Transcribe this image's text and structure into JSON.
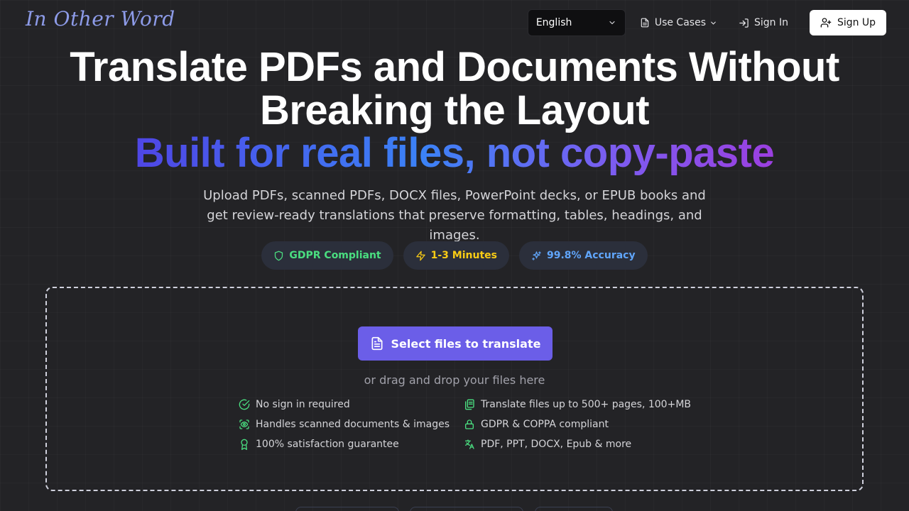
{
  "header": {
    "logo": "In Other Word",
    "language": "English",
    "use_cases": "Use Cases",
    "sign_in": "Sign In",
    "sign_up": "Sign Up"
  },
  "hero": {
    "title": "Translate PDFs and Documents Without Breaking the Layout",
    "subtitle": "Built for real files, not copy-paste",
    "description": "Upload PDFs, scanned PDFs, DOCX files, PowerPoint decks, or EPUB books and get review-ready translations that preserve formatting, tables, headings, and images."
  },
  "badges": [
    {
      "label": "GDPR Compliant",
      "icon": "shield-icon",
      "color": "#4ade80"
    },
    {
      "label": "1-3 Minutes",
      "icon": "lightning-icon",
      "color": "#facc15"
    },
    {
      "label": "99.8% Accuracy",
      "icon": "sparkles-icon",
      "color": "#60a5fa"
    }
  ],
  "upload": {
    "button": "Select files to translate",
    "drag_text": "or drag and drop your files here",
    "features": [
      {
        "label": "No sign in required",
        "icon": "check-circle-icon"
      },
      {
        "label": "Translate files up to 500+ pages, 100+MB",
        "icon": "files-icon"
      },
      {
        "label": "Handles scanned documents & images",
        "icon": "scan-eye-icon"
      },
      {
        "label": "GDPR & COPPA compliant",
        "icon": "lock-icon"
      },
      {
        "label": "100% satisfaction guarantee",
        "icon": "award-icon"
      },
      {
        "label": "PDF, PPT, DOCX, Epub & more",
        "icon": "translate-icon"
      }
    ]
  },
  "colors": {
    "accent": "#6b5ee8",
    "logo": "#8d9be8",
    "feature_icon": "#4ade80"
  }
}
